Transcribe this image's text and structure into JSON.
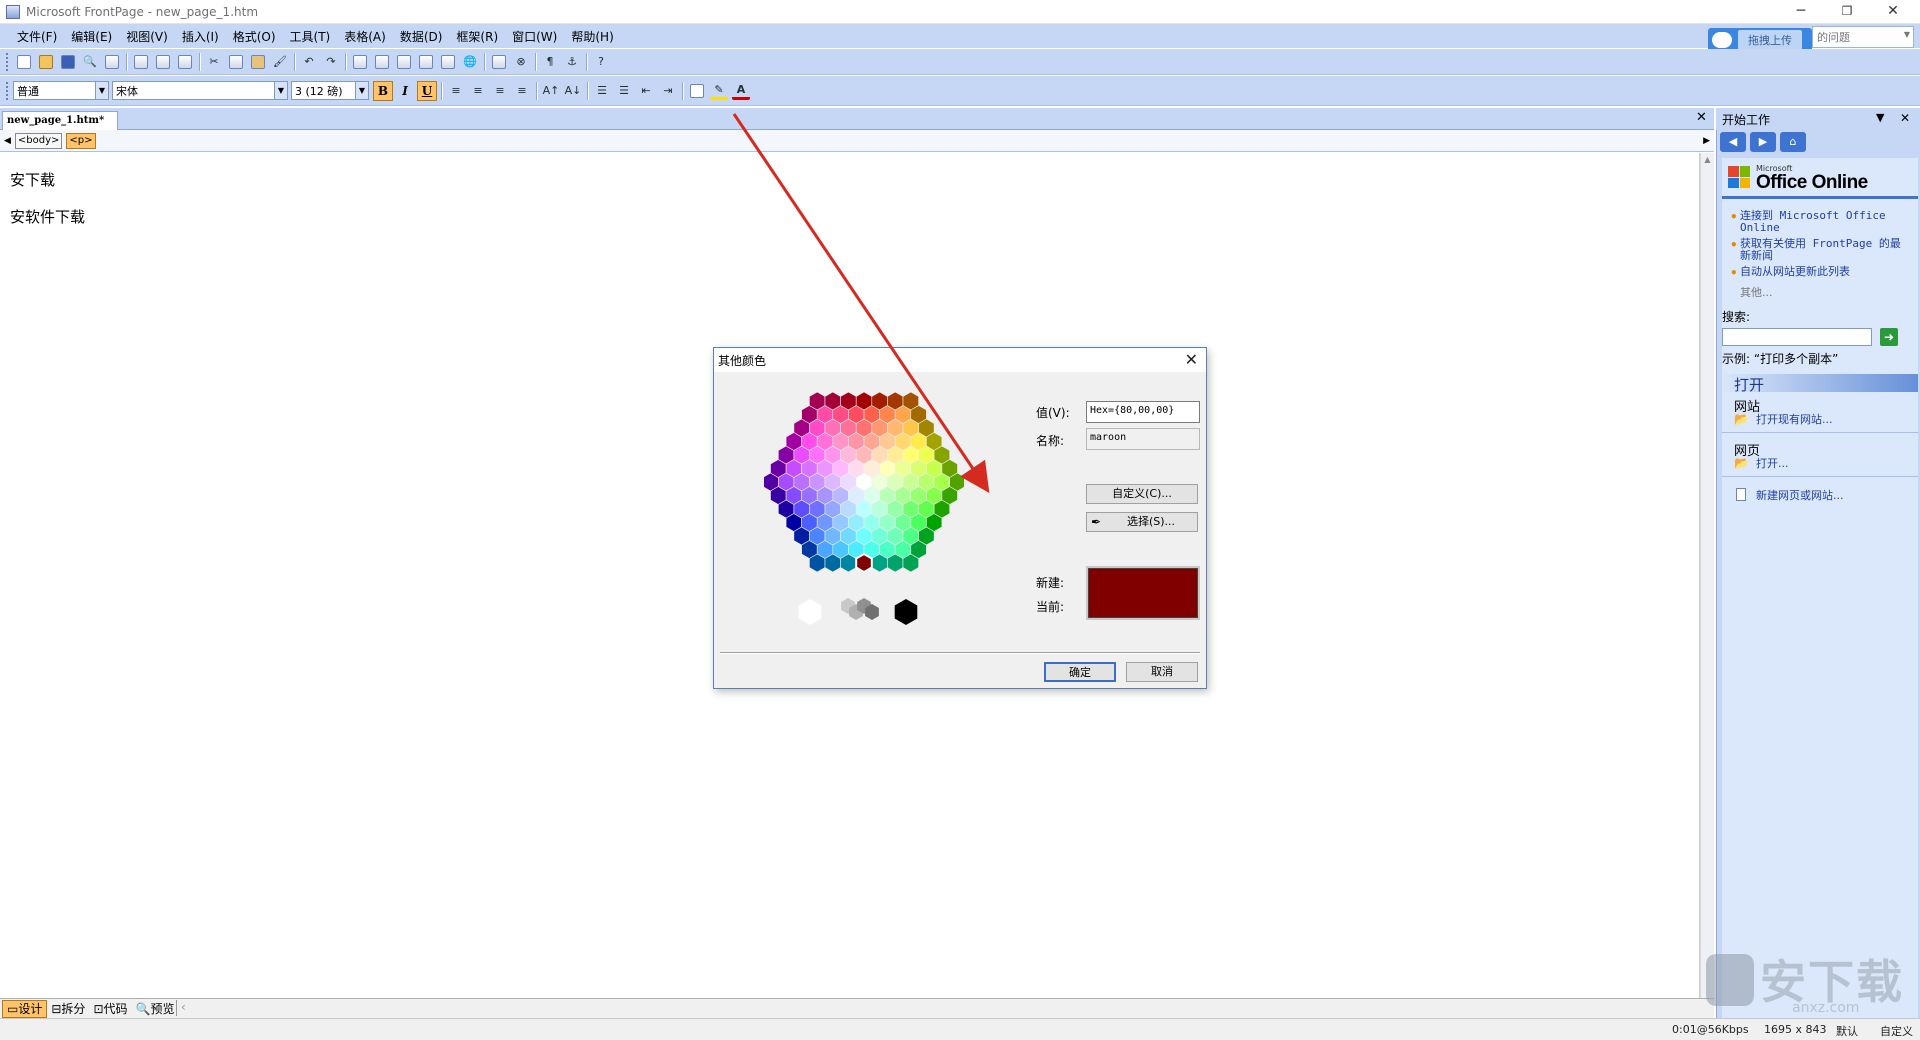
{
  "window": {
    "title": "Microsoft FrontPage - new_page_1.htm",
    "minimize": "─",
    "restore": "❐",
    "close": "✕"
  },
  "menu": [
    "文件(F)",
    "编辑(E)",
    "视图(V)",
    "插入(I)",
    "格式(O)",
    "工具(T)",
    "表格(A)",
    "数据(D)",
    "框架(R)",
    "窗口(W)",
    "帮助(H)"
  ],
  "upload_button": "拖拽上传",
  "help_search": {
    "placeholder": "的问题"
  },
  "format_toolbar": {
    "style": "普通",
    "font": "宋体",
    "size": "3 (12 磅)",
    "bold": "B",
    "italic": "I",
    "underline": "U"
  },
  "document": {
    "tab": "new_page_1.htm*",
    "tags": [
      "<body>",
      "<p>"
    ],
    "lines": [
      "安下载",
      "安软件下载"
    ]
  },
  "view_tabs": [
    "设计",
    "拆分",
    "代码",
    "预览"
  ],
  "status": {
    "speed": "0:01@56Kbps",
    "size": "1695 x 843",
    "mode1": "默认",
    "mode2": "自定义"
  },
  "task_pane": {
    "title": "开始工作",
    "brand_small": "Microsoft",
    "brand": "Office Online",
    "links": [
      "连接到 Microsoft Office Online",
      "获取有关使用 FrontPage 的最新新闻",
      "自动从网站更新此列表"
    ],
    "more": "其他...",
    "search_label": "搜索:",
    "example": "示例: “打印多个副本”",
    "open_title": "打开",
    "website_label": "网站",
    "open_website": "打开现有网站...",
    "page_label": "网页",
    "open_page": "打开...",
    "new_site": "新建网页或网站..."
  },
  "dialog": {
    "title": "其他颜色",
    "value_label": "值(V):",
    "value": "Hex={80,00,00}",
    "name_label": "名称:",
    "name": "maroon",
    "custom_button": "自定义(C)...",
    "select_button": "选择(S)...",
    "new_label": "新建:",
    "current_label": "当前:",
    "ok": "确定",
    "cancel": "取消",
    "selected_color": "#800000"
  },
  "watermark_text": "安下载",
  "watermark_sub": "anxz.com",
  "colors": {
    "menubar": "#c5d7f4",
    "pane": "#dbe7fa",
    "accent": "#3a86e0",
    "highlight": "#ffc469"
  }
}
